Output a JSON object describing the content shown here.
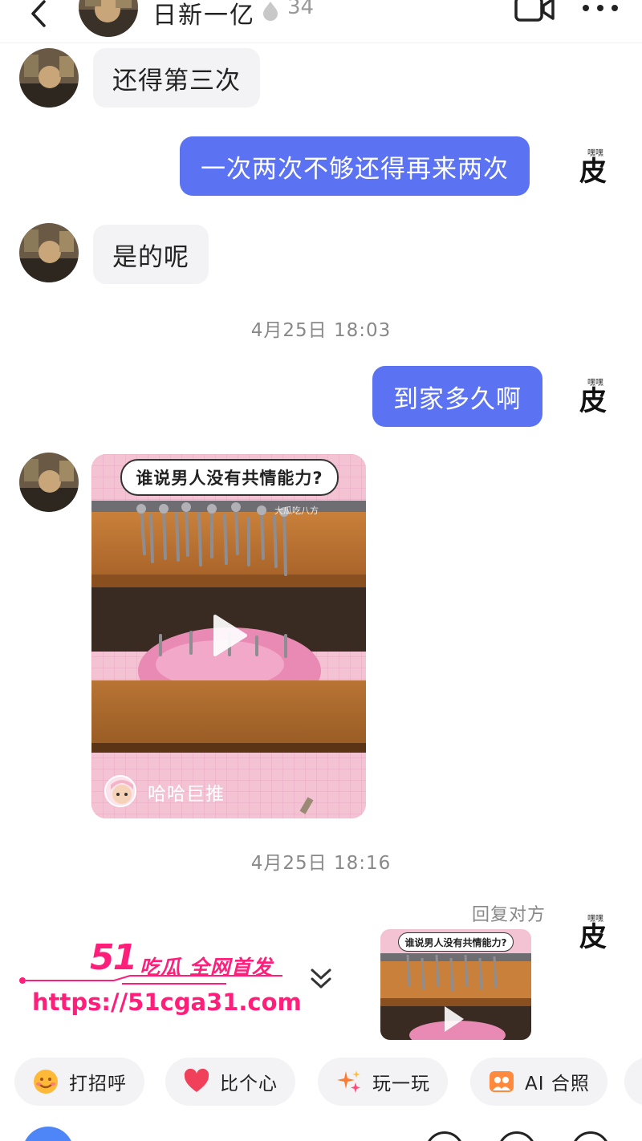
{
  "header": {
    "name": "日新一亿",
    "count": "34"
  },
  "messages": [
    {
      "side": "left",
      "text": "还得第三次"
    },
    {
      "side": "right",
      "text": "一次两次不够还得再来两次"
    },
    {
      "side": "left",
      "text": "是的呢"
    },
    {
      "side": "right",
      "text": "到家多久啊"
    }
  ],
  "timestamps": [
    "4月25日 18:03",
    "4月25日 18:16"
  ],
  "self_avatar": {
    "small": "嘿嘿",
    "big": "皮"
  },
  "video_card": {
    "title": "谁说男人没有共情能力?",
    "watermark": "大瓜吃八方",
    "author": "哈哈巨推"
  },
  "reply": {
    "label": "回复对方",
    "thumb_title": "谁说男人没有共情能力?"
  },
  "watermark": {
    "brand": "51",
    "tagline": "吃瓜 全网首发",
    "url": "https://51cga31.com"
  },
  "quick_actions": [
    {
      "label": "打招呼",
      "icon": "smile-emoji-icon"
    },
    {
      "label": "比个心",
      "icon": "heart-icon"
    },
    {
      "label": "玩一玩",
      "icon": "sparkle-icon"
    },
    {
      "label": "AI 合照",
      "icon": "photo-icon"
    }
  ],
  "colors": {
    "accent": "#5b73f2",
    "bubble_left": "#f3f3f5",
    "watermark": "#ff1f7a"
  }
}
